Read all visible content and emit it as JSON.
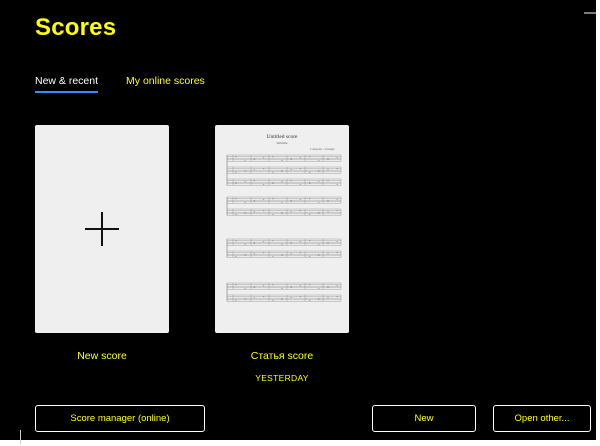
{
  "header": {
    "title": "Scores"
  },
  "tabs": [
    {
      "label": "New & recent",
      "active": true
    },
    {
      "label": "My online scores",
      "active": false
    }
  ],
  "cards": {
    "new_score": {
      "label": "New score",
      "icon": "plus-icon"
    },
    "recent_score": {
      "label": "Статья score",
      "date": "YESTERDAY",
      "thumbnail": {
        "title": "Untitled score",
        "subtitle": "Subtitle",
        "composer": "Composer / arranger"
      }
    }
  },
  "footer": {
    "score_manager_label": "Score manager (online)",
    "new_label": "New",
    "open_other_label": "Open other..."
  },
  "colors": {
    "background": "#000000",
    "accent_text": "#ffff00",
    "active_tab_underline": "#2f8fff",
    "card_background": "#efefef"
  }
}
